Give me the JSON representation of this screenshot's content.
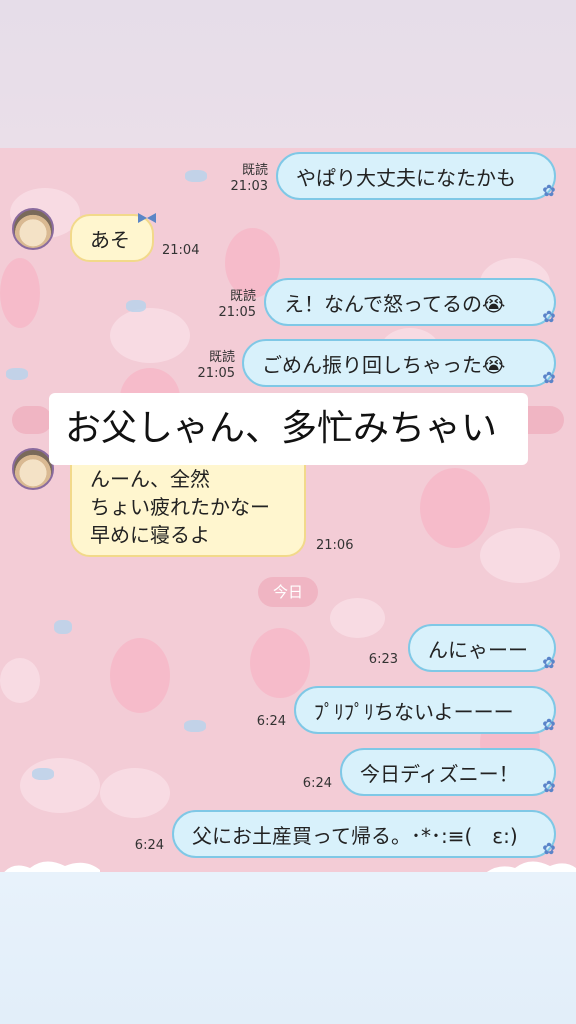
{
  "caption": "お父しゃん、多忙みちゃい",
  "date_divider": "今日",
  "messages": [
    {
      "side": "me",
      "text": "やぱり大丈夫になたかも",
      "read": "既読",
      "time": "21:03"
    },
    {
      "side": "them",
      "text": "あそ",
      "time": "21:04"
    },
    {
      "side": "me",
      "text": "え！なんで怒ってるの😭",
      "read": "既読",
      "time": "21:05"
    },
    {
      "side": "me",
      "text": "ごめん振り回しちゃった😭",
      "read": "既読",
      "time": "21:05"
    },
    {
      "side": "them",
      "lines": [
        "んーん、全然",
        "ちょい疲れたかなー",
        "早めに寝るよ"
      ],
      "time": "21:06"
    },
    {
      "side": "me",
      "text": "んにゃーー",
      "time": "6:23"
    },
    {
      "side": "me",
      "text": "ﾌﾟﾘﾌﾟﾘちないよーーー",
      "time": "6:24"
    },
    {
      "side": "me",
      "text": "今日ディズニー！",
      "time": "6:24"
    },
    {
      "side": "me",
      "text": "父にお土産買って帰る。･*･:≡(　ε:)",
      "time": "6:24"
    }
  ],
  "colors": {
    "chat_bg": "#f3ccd6",
    "my_bubble": "#d8f1fb",
    "my_border": "#7fc8e6",
    "their_bubble": "#fff6cf",
    "their_border": "#f2d98a"
  },
  "icons": {
    "avatar": "cat-avatar-icon",
    "bubble_tail": "flower-icon",
    "bow": "bow-icon"
  }
}
